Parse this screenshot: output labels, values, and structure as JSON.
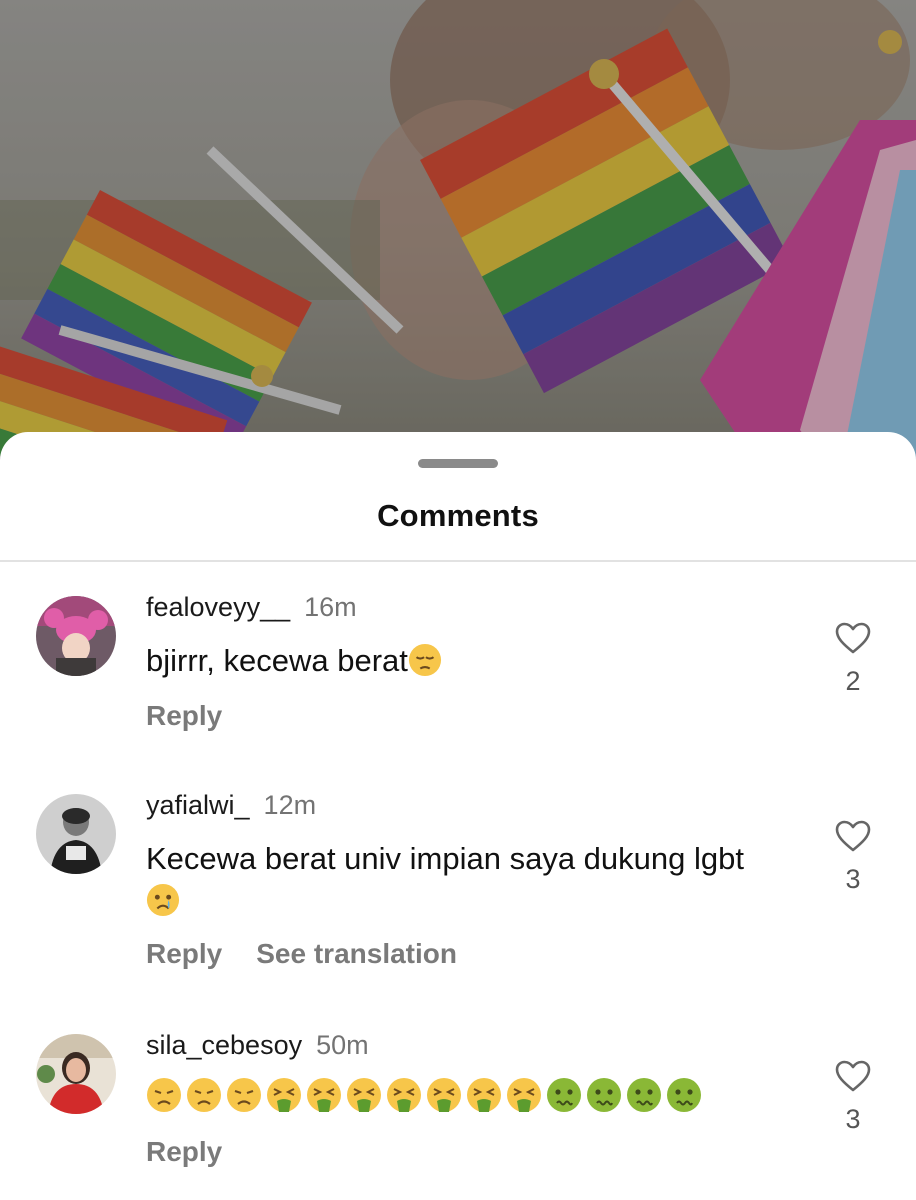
{
  "sheet": {
    "title": "Comments"
  },
  "comments": [
    {
      "username": "fealoveyy__",
      "time": "16m",
      "text": "bjirrr, kecewa berat",
      "text_emoji": [
        "pensive-face-emoji"
      ],
      "actions": [
        "Reply"
      ],
      "likes": "2",
      "avatar": "avatar-pink-hat"
    },
    {
      "username": "yafialwi_",
      "time": "12m",
      "text": "Kecewa berat univ impian saya dukung lgbt",
      "text_emoji": [
        "crying-face-emoji"
      ],
      "actions": [
        "Reply",
        "See translation"
      ],
      "likes": "3",
      "avatar": "avatar-grayscale"
    },
    {
      "username": "sila_cebesoy",
      "time": "50m",
      "text": "",
      "text_emoji": [
        "disappointed-face-emoji",
        "disappointed-face-emoji",
        "disappointed-face-emoji",
        "vomiting-face-emoji",
        "vomiting-face-emoji",
        "vomiting-face-emoji",
        "vomiting-face-emoji",
        "vomiting-face-emoji",
        "vomiting-face-emoji",
        "vomiting-face-emoji",
        "nauseated-face-emoji",
        "nauseated-face-emoji",
        "nauseated-face-emoji",
        "nauseated-face-emoji"
      ],
      "actions": [
        "Reply"
      ],
      "likes": "3",
      "avatar": "avatar-red-sweater"
    }
  ],
  "colors": {
    "username": "#1a1a1a",
    "secondary": "#737373",
    "heart_outline": "#666666"
  }
}
